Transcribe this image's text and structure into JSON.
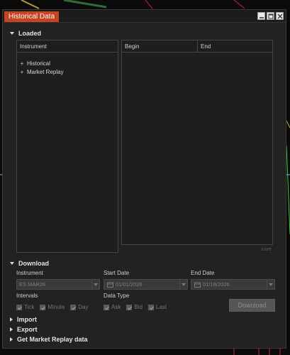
{
  "window": {
    "title": "Historical Data"
  },
  "loaded": {
    "header": "Loaded",
    "instrument_col": "Instrument",
    "tree": [
      {
        "label": "Historical"
      },
      {
        "label": "Market Replay"
      }
    ],
    "begin_col": "Begin",
    "end_col": "End",
    "save_label": "save"
  },
  "download": {
    "header": "Download",
    "instrument_label": "Instrument",
    "instrument_value": "ES MAR26",
    "start_label": "Start Date",
    "start_value": "01/01/2026",
    "end_label": "End Date",
    "end_value": "01/18/2026",
    "intervals_label": "Intervals",
    "intervals": [
      {
        "label": "Tick",
        "checked": true
      },
      {
        "label": "Minute",
        "checked": true
      },
      {
        "label": "Day",
        "checked": true
      }
    ],
    "datatype_label": "Data Type",
    "datatypes": [
      {
        "label": "Ask",
        "checked": true
      },
      {
        "label": "Bid",
        "checked": true
      },
      {
        "label": "Last",
        "checked": true
      }
    ],
    "button_label": "Download"
  },
  "sections": [
    {
      "label": "Import"
    },
    {
      "label": "Export"
    },
    {
      "label": "Get Market Replay data"
    }
  ],
  "colors": {
    "title_accent": "#c9431f",
    "background": "#222222"
  }
}
